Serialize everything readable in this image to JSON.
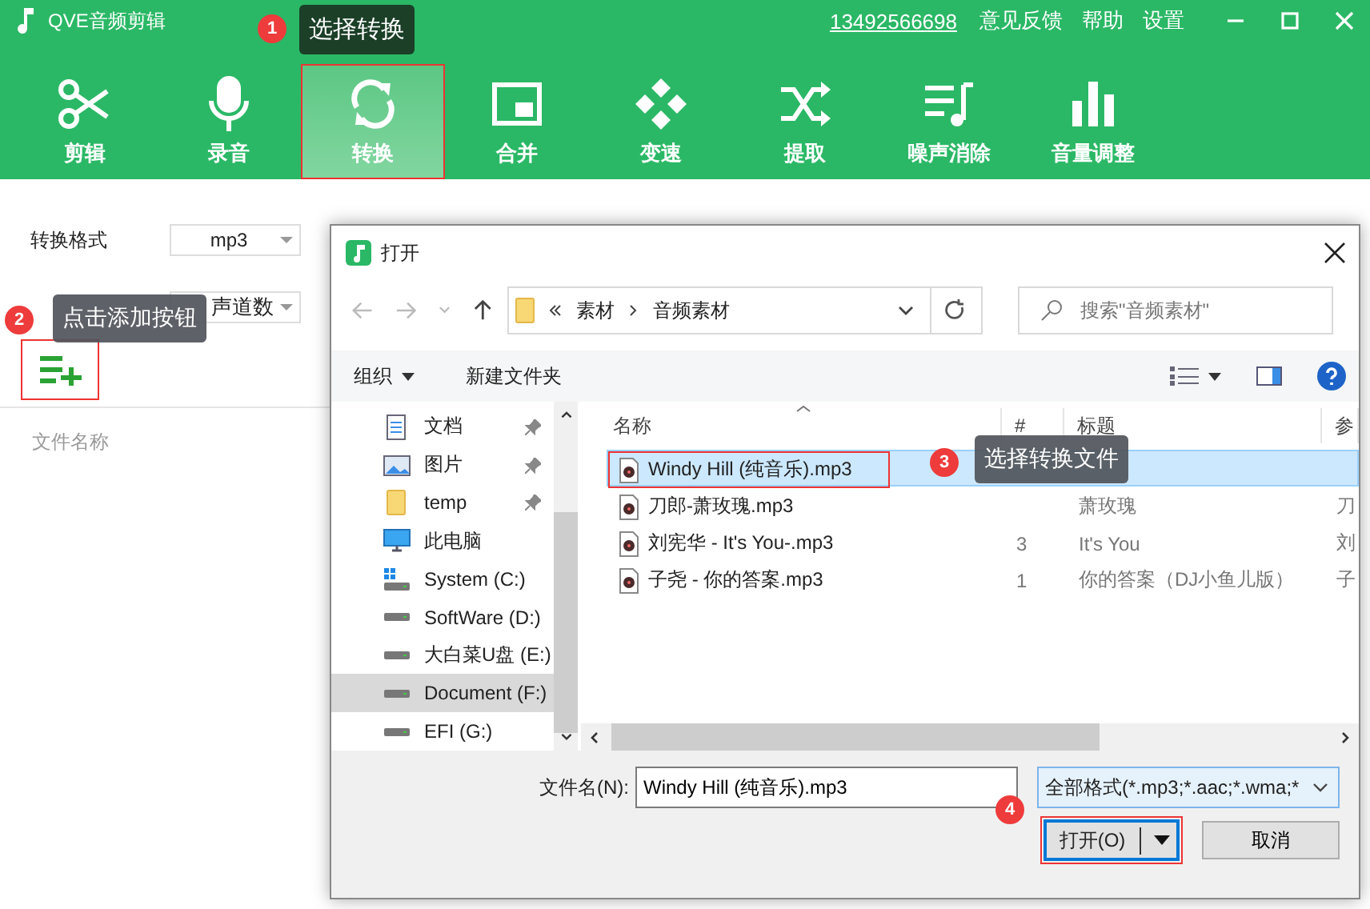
{
  "app": {
    "title": "QVE音频剪辑",
    "phone": "13492566698",
    "links": [
      "意见反馈",
      "帮助",
      "设置"
    ]
  },
  "toolbar": [
    {
      "label": "剪辑",
      "kind": "scissors",
      "selected": false,
      "highlighted": false
    },
    {
      "label": "录音",
      "kind": "mic",
      "selected": false,
      "highlighted": false
    },
    {
      "label": "转换",
      "kind": "refresh",
      "selected": true,
      "highlighted": true
    },
    {
      "label": "合并",
      "kind": "merge",
      "selected": false,
      "highlighted": false
    },
    {
      "label": "变速",
      "kind": "dpad",
      "selected": false,
      "highlighted": false
    },
    {
      "label": "提取",
      "kind": "shuffle",
      "selected": false,
      "highlighted": false
    },
    {
      "label": "噪声消除",
      "kind": "playlist",
      "selected": false,
      "highlighted": false
    },
    {
      "label": "音量调整",
      "kind": "bars",
      "selected": false,
      "highlighted": false
    }
  ],
  "settings": {
    "format_label": "转换格式",
    "format_value": "mp3",
    "channels_value": "声道数",
    "add_button_highlighted": true,
    "file_name_column": "文件名称"
  },
  "dialog": {
    "title": "打开",
    "breadcrumb": [
      "素材",
      "音频素材"
    ],
    "search_placeholder": "搜索\"音频素材\"",
    "commands": [
      {
        "label": "组织",
        "dropdown": true
      },
      {
        "label": "新建文件夹",
        "dropdown": false
      }
    ],
    "nav": [
      {
        "label": "文档",
        "kind": "document",
        "pinned": true,
        "selected": false
      },
      {
        "label": "图片",
        "kind": "image",
        "pinned": true,
        "selected": false
      },
      {
        "label": "temp",
        "kind": "folder",
        "pinned": true,
        "selected": false
      },
      {
        "label": "此电脑",
        "kind": "pc",
        "pinned": false,
        "selected": false,
        "children": [
          {
            "label": "System (C:)",
            "kind": "system-drive",
            "pinned": false,
            "selected": false
          },
          {
            "label": "SoftWare (D:)",
            "kind": "drive",
            "pinned": false,
            "selected": false
          },
          {
            "label": "大白菜U盘 (E:)",
            "kind": "drive",
            "pinned": false,
            "selected": false
          },
          {
            "label": "Document (F:)",
            "kind": "drive",
            "pinned": false,
            "selected": true
          },
          {
            "label": "EFI (G:)",
            "kind": "drive",
            "pinned": false,
            "selected": false
          }
        ]
      }
    ],
    "columns": [
      "名称",
      "#",
      "标题",
      "参"
    ],
    "rows": [
      {
        "name": "Windy Hill (纯音乐).mp3",
        "number": "",
        "title": "",
        "artist": "",
        "selected": true,
        "highlighted": true
      },
      {
        "name": "刀郎-萧玫瑰.mp3",
        "number": "",
        "title": "萧玫瑰",
        "artist": "刀",
        "selected": false,
        "highlighted": false
      },
      {
        "name": "刘宪华 - It's You-.mp3",
        "number": "3",
        "title": "It's You",
        "artist": "刘",
        "selected": false,
        "highlighted": false
      },
      {
        "name": "子尧 - 你的答案.mp3",
        "number": "1",
        "title": "你的答案（DJ小鱼儿版）",
        "artist": "子",
        "selected": false,
        "highlighted": false
      }
    ],
    "filename_label": "文件名(N):",
    "filename_value": "Windy Hill (纯音乐).mp3",
    "filter": "全部格式(*.mp3;*.aac;*.wma;*",
    "open_button": "打开(O)",
    "open_highlighted": true,
    "cancel_button": "取消"
  },
  "annotations": [
    {
      "number": "1",
      "text": "选择转换"
    },
    {
      "number": "2",
      "text": "点击添加按钮"
    },
    {
      "number": "3",
      "text": "选择转换文件"
    },
    {
      "number": "4"
    }
  ]
}
